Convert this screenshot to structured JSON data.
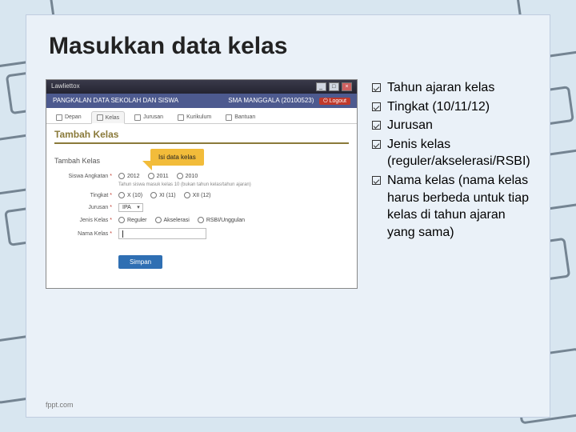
{
  "slide": {
    "title": "Masukkan data kelas",
    "footer": "fppt.com"
  },
  "screenshot": {
    "window_app": "Lawliettox",
    "header": "PANGKALAN DATA SEKOLAH DAN SISWA",
    "school": "SMA MANGGALA (20100523)",
    "logout": "Logout",
    "tabs": {
      "depan": "Depan",
      "kelas": "Kelas",
      "jurusan": "Jurusan",
      "kurikulum": "Kurikulum",
      "bantuan": "Bantuan"
    },
    "page_title": "Tambah Kelas",
    "callout": "Isi data kelas",
    "form_title": "Tambah Kelas",
    "labels": {
      "angkatan": "Siswa Angkatan",
      "tingkat": "Tingkat",
      "jurusan": "Jurusan",
      "jenis": "Jenis Kelas",
      "nama": "Nama Kelas"
    },
    "angkatan_opts": {
      "a": "2012",
      "b": "2011",
      "c": "2010"
    },
    "angkatan_note": "Tahun siswa masuk kelas 10 (bukan tahun kelas/tahun ajaran)",
    "tingkat_opts": {
      "a": "X (10)",
      "b": "XI (11)",
      "c": "XII (12)"
    },
    "jurusan_value": "IPA",
    "jenis_opts": {
      "a": "Reguler",
      "b": "Akselerasi",
      "c": "RSBI/Unggulan"
    },
    "save": "Simpan"
  },
  "bullets": {
    "b1": "Tahun ajaran kelas",
    "b2": "Tingkat (10/11/12)",
    "b3": "Jurusan",
    "b4": "Jenis kelas (reguler/akselerasi/RSBI)",
    "b5": "Nama kelas (nama kelas harus berbeda untuk tiap kelas di tahun ajaran yang sama)"
  }
}
